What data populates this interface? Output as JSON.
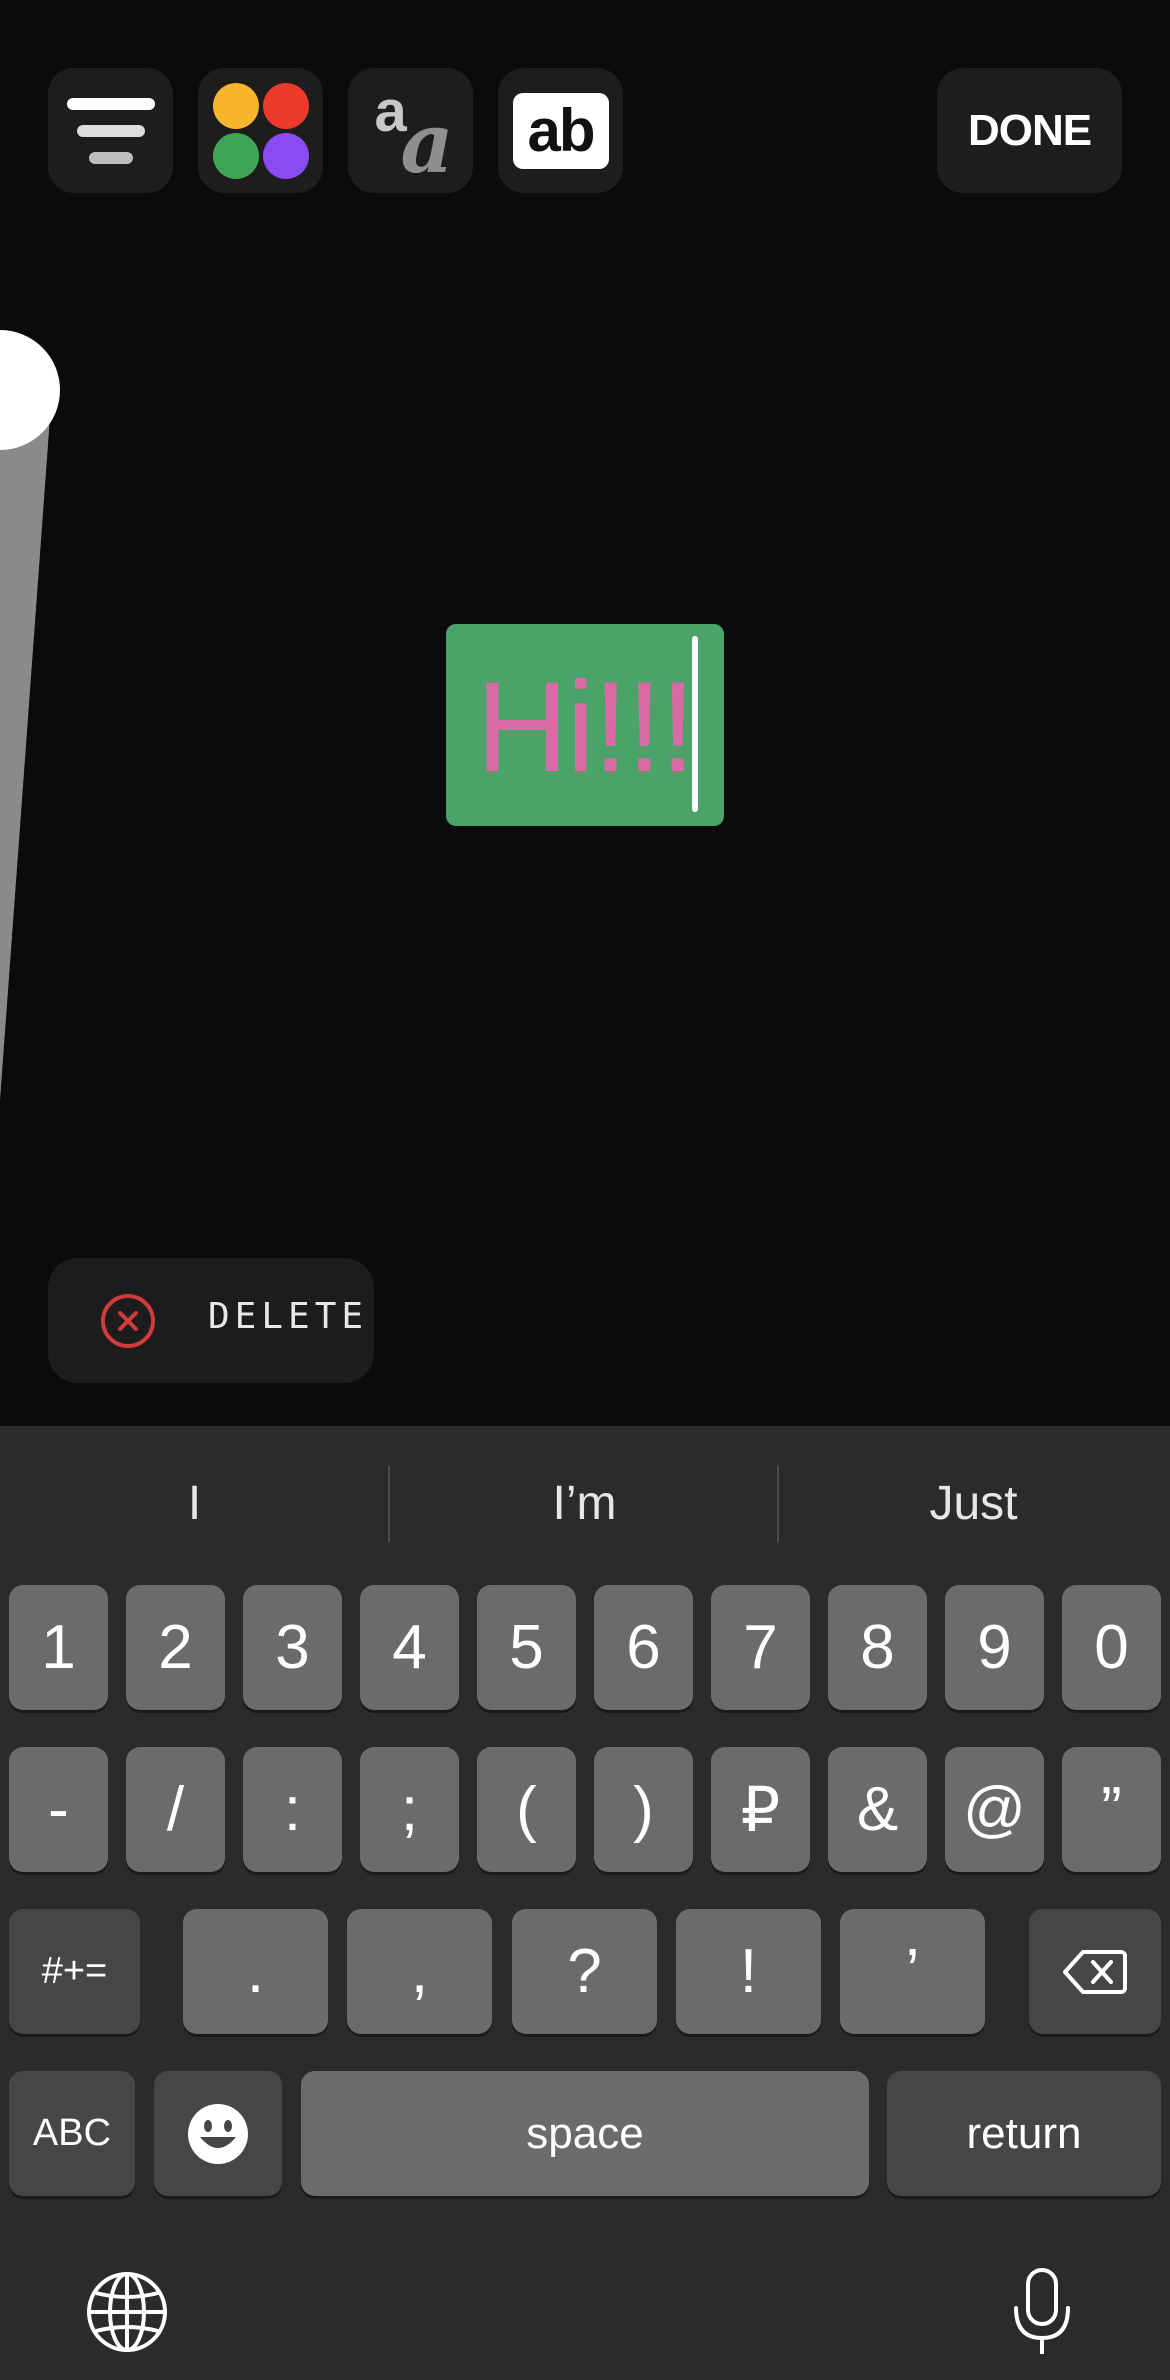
{
  "toolbar": {
    "align_icon": "text-align-center-icon",
    "color_icon": "color-palette-icon",
    "font_icon": "font-style-icon",
    "background_icon": "text-background-icon",
    "font_glyph_a": "a",
    "font_glyph_b": "a",
    "background_glyph": "ab",
    "done_label": "DONE"
  },
  "palette_colors": [
    "#f7b52b",
    "#ee3a2a",
    "#3fa554",
    "#8a4cf2"
  ],
  "text_object": {
    "text": "Hi!!!",
    "text_color": "#d96aa3",
    "background_color": "#4ba36a"
  },
  "delete": {
    "label": "DELETE",
    "icon": "close-circle-icon"
  },
  "keyboard": {
    "suggestions": [
      "I",
      "I’m",
      "Just"
    ],
    "row1": [
      "1",
      "2",
      "3",
      "4",
      "5",
      "6",
      "7",
      "8",
      "9",
      "0"
    ],
    "row2": [
      "-",
      "/",
      ":",
      ";",
      "(",
      ")",
      "₽",
      "&",
      "@",
      "”"
    ],
    "row3": {
      "shift_label": "#+=",
      "keys": [
        ".",
        ",",
        "?",
        "!",
        "’"
      ],
      "backspace_icon": "backspace-icon"
    },
    "row4": {
      "abc_label": "ABC",
      "emoji_icon": "emoji-icon",
      "space_label": "space",
      "return_label": "return"
    },
    "globe_icon": "globe-icon",
    "mic_icon": "microphone-icon"
  }
}
